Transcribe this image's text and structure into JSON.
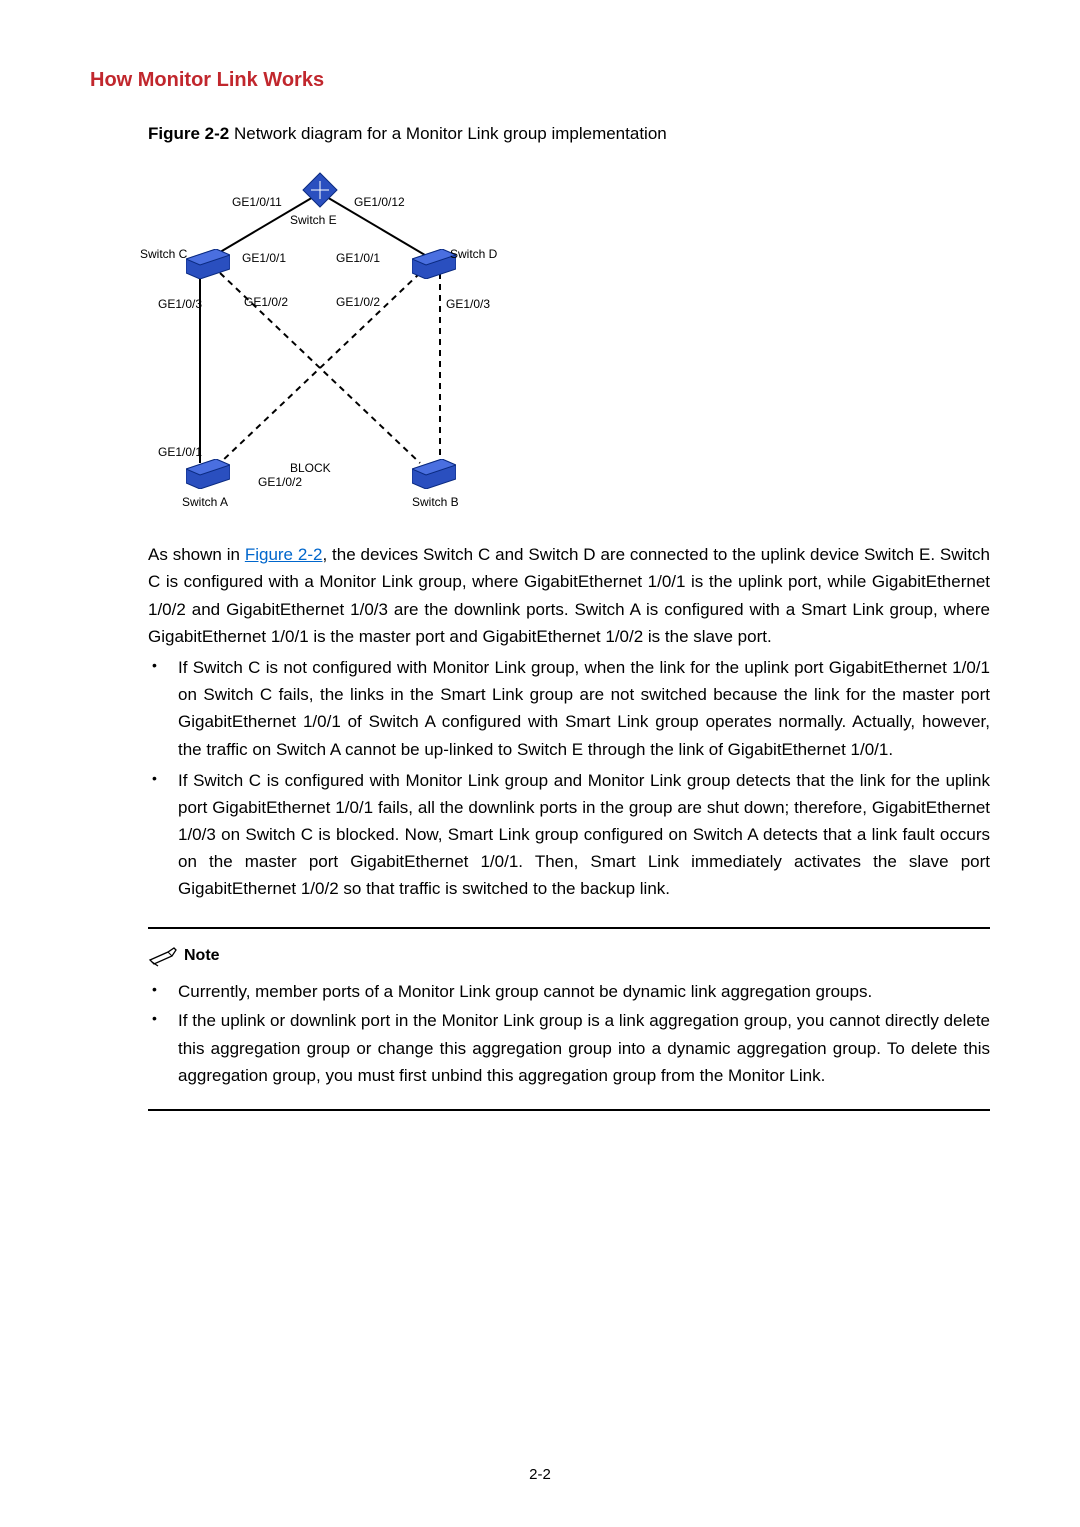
{
  "section_title": "How Monitor Link Works",
  "figure": {
    "caption_bold": "Figure 2-2",
    "caption_rest": " Network diagram for a Monitor Link group implementation",
    "labels": {
      "switchE": "Switch E",
      "switchC": "Switch C",
      "switchD": "Switch D",
      "switchA": "Switch A",
      "switchB": "Switch B",
      "ge1011": "GE1/0/11",
      "ge1012": "GE1/0/12",
      "ge101_left": "GE1/0/1",
      "ge101_right": "GE1/0/1",
      "ge102_cl": "GE1/0/2",
      "ge102_dr": "GE1/0/2",
      "ge103_cl": "GE1/0/3",
      "ge103_dr": "GE1/0/3",
      "ge101_a": "GE1/0/1",
      "ge102_a": "GE1/0/2",
      "block": "BLOCK"
    }
  },
  "intro_pre": "As shown in ",
  "intro_link": "Figure 2-2",
  "intro_post": ", the devices Switch C and Switch D are connected to the uplink device Switch E. Switch C is configured with a Monitor Link group, where GigabitEthernet 1/0/1 is the uplink port, while GigabitEthernet 1/0/2 and GigabitEthernet 1/0/3 are the downlink ports. Switch A is configured with a Smart Link group, where GigabitEthernet 1/0/1 is the master port and GigabitEthernet 1/0/2 is the slave port.",
  "bullets": [
    "If Switch C is not configured with Monitor Link group, when the link for the uplink port GigabitEthernet 1/0/1 on Switch C fails, the links in the Smart Link group are not switched because the link for the master port GigabitEthernet 1/0/1 of Switch A configured with Smart Link group operates normally. Actually, however, the traffic on Switch A cannot be up-linked to Switch E through the link of GigabitEthernet 1/0/1.",
    "If Switch C is configured with Monitor Link group and Monitor Link group detects that the link for the uplink port GigabitEthernet 1/0/1 fails, all the downlink ports in the group are shut down; therefore, GigabitEthernet 1/0/3 on Switch C is blocked. Now, Smart Link group configured on Switch A detects that a link fault occurs on the master port GigabitEthernet 1/0/1. Then, Smart Link immediately activates the slave port GigabitEthernet 1/0/2 so that traffic is switched to the backup link."
  ],
  "note": {
    "label": "Note",
    "items": [
      "Currently, member ports of a Monitor Link group cannot be dynamic link aggregation groups.",
      "If the uplink or downlink port in the Monitor Link group is a link aggregation group, you cannot directly delete this aggregation group or change this aggregation group into a dynamic aggregation group. To delete this aggregation group, you must first unbind this aggregation group from the Monitor Link."
    ]
  },
  "page_number": "2-2"
}
